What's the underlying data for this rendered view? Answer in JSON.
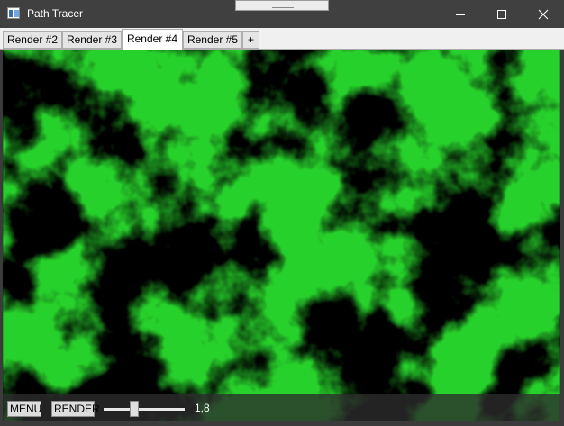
{
  "window": {
    "title": "Path Tracer"
  },
  "icons": {
    "app": "app-icon",
    "minimize": "minimize-icon",
    "maximize": "maximize-icon",
    "close": "close-icon"
  },
  "tabs": [
    {
      "label": "Render #2",
      "active": false
    },
    {
      "label": "Render #3",
      "active": false
    },
    {
      "label": "Render #4",
      "active": true
    },
    {
      "label": "Render #5",
      "active": false
    },
    {
      "label": "+",
      "active": false
    }
  ],
  "toolbar": {
    "menu_label": "MENU",
    "render_label": "RENDER",
    "slider": {
      "value": 1.8,
      "min": 0,
      "max": 5,
      "display": "1,8"
    }
  },
  "colors": {
    "render_glow": "#27d12b",
    "render_background": "#000000",
    "titlebar": "#404040"
  }
}
